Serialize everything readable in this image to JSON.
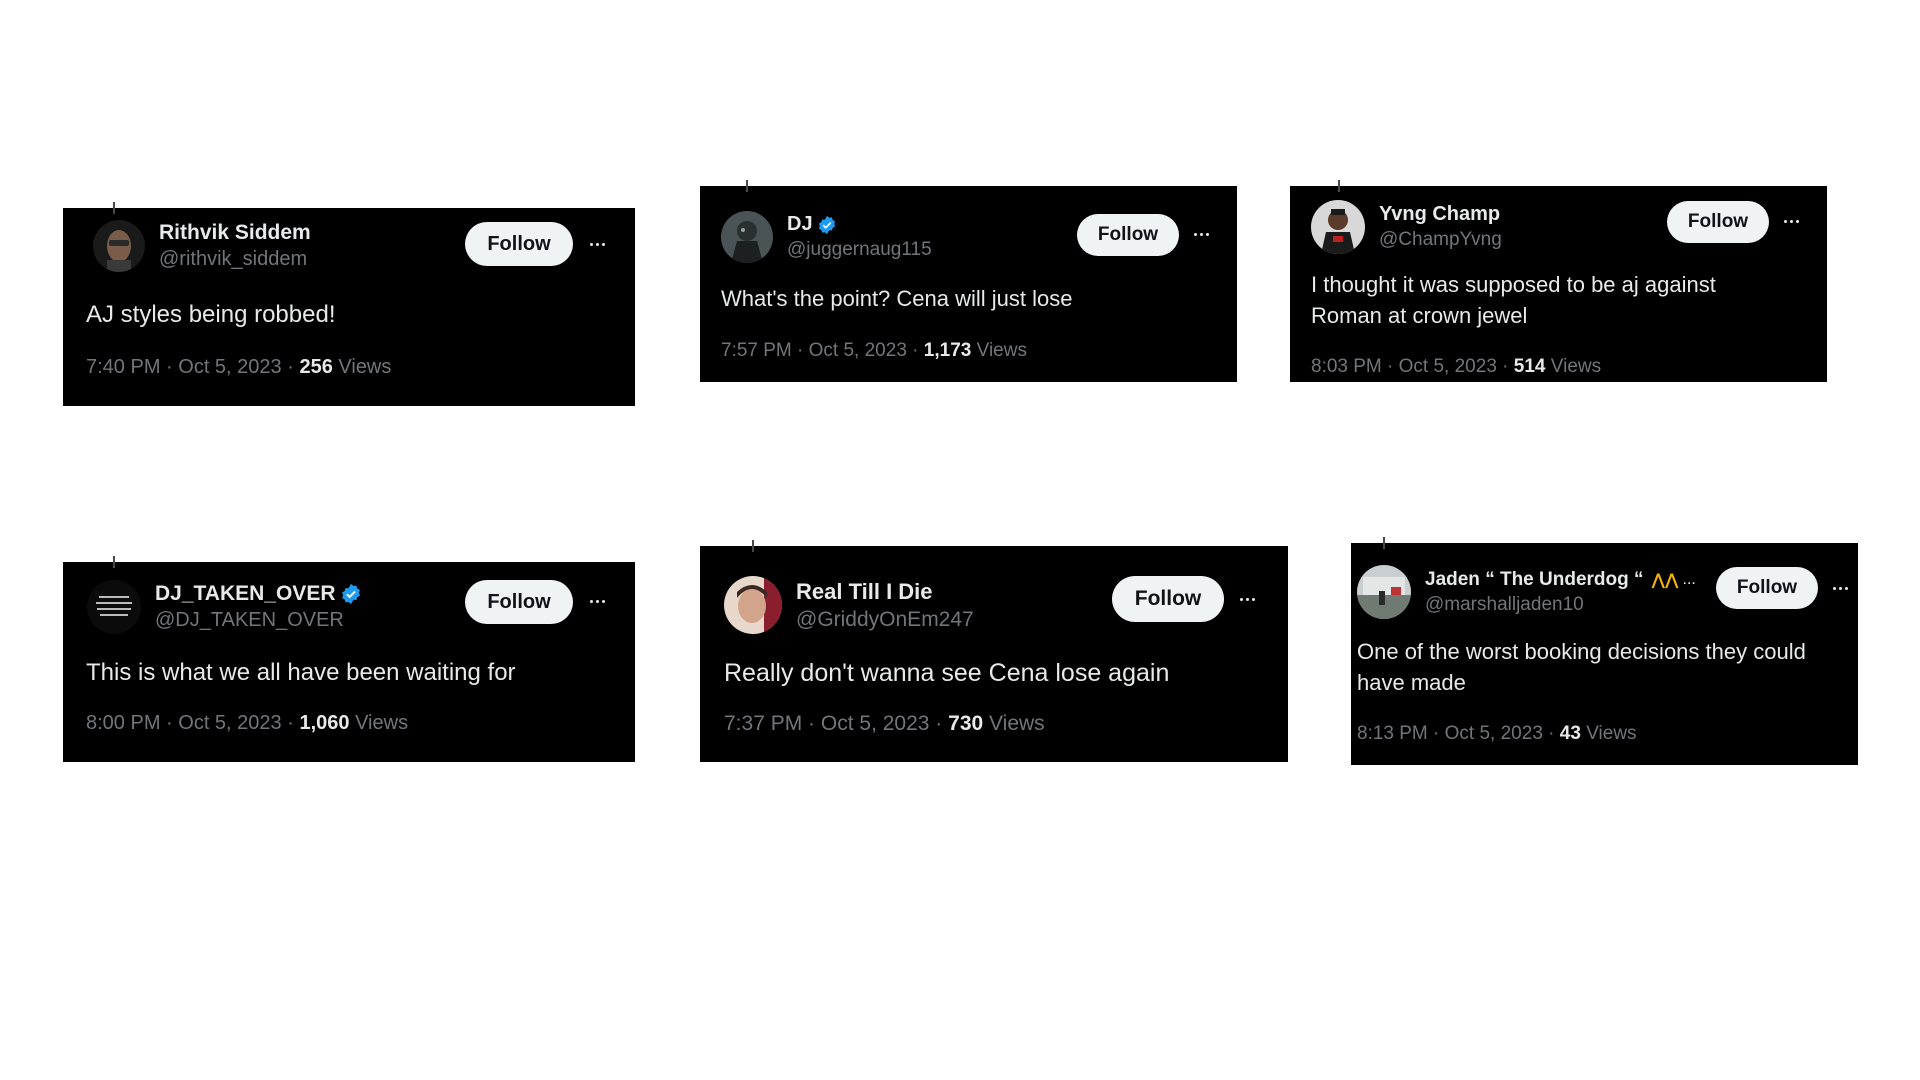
{
  "follow_label": "Follow",
  "views_label": "Views",
  "colors": {
    "card_bg": "#000000",
    "text_primary": "#e7e9ea",
    "text_secondary": "#71767b",
    "button_bg": "#eff3f4",
    "button_text": "#0f1419",
    "verified_blue": "#1d9bf0"
  },
  "tweets": [
    {
      "name": "Rithvik Siddem",
      "handle": "@rithvik_siddem",
      "verified": false,
      "text": "AJ styles being robbed!",
      "time": "7:40 PM",
      "date": "Oct 5, 2023",
      "views": "256"
    },
    {
      "name": "DJ",
      "handle": "@juggernaug115",
      "verified": true,
      "text": "What's the point? Cena will just lose",
      "time": "7:57 PM",
      "date": "Oct 5, 2023",
      "views": "1,173"
    },
    {
      "name": "Yvng Champ",
      "handle": "@ChampYvng",
      "verified": false,
      "text": "I thought it was supposed to be aj against Roman at crown jewel",
      "time": "8:03 PM",
      "date": "Oct 5, 2023",
      "views": "514"
    },
    {
      "name": "DJ_TAKEN_OVER",
      "handle": "@DJ_TAKEN_OVER",
      "verified": true,
      "text": "This is what we all have been waiting for",
      "time": "8:00 PM",
      "date": "Oct 5, 2023",
      "views": "1,060",
      "avatar_text": "SOME SAY YOU MAY I MAKE IT ONLY BECAUSE THEY DIDN'T MAKE IT"
    },
    {
      "name": "Real Till I Die",
      "handle": "@GriddyOnEm247",
      "verified": false,
      "text": "Really don't wanna see Cena lose again",
      "time": "7:37 PM",
      "date": "Oct 5, 2023",
      "views": "730"
    },
    {
      "name": "Jaden “ The Underdog “",
      "name_suffix": "...",
      "handle": "@marshalljaden10",
      "verified": false,
      "text": "One of the worst booking decisions they could have made",
      "time": "8:13 PM",
      "date": "Oct 5, 2023",
      "views": "43"
    }
  ]
}
